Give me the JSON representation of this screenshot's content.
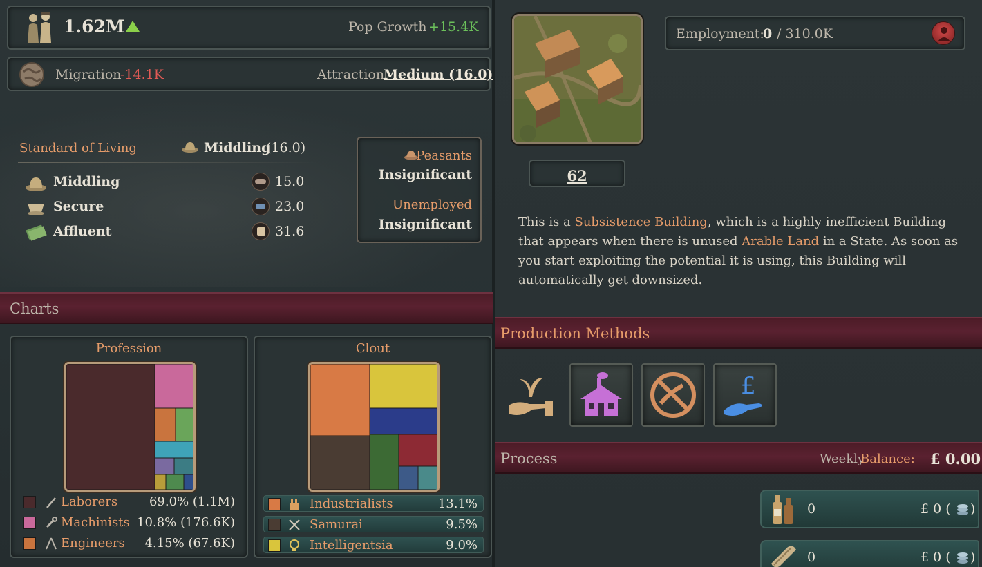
{
  "population": {
    "total": "1.62M",
    "growth_label": "Pop Growth",
    "growth_value": "+15.4K"
  },
  "migration": {
    "label": "Migration",
    "value": "-14.1K",
    "attraction_label": "Attraction",
    "attraction_value": "Medium (16.0)"
  },
  "standard_of_living": {
    "label": "Standard of Living",
    "value_name": "Middling",
    "value_num": "(16.0)",
    "levels": [
      {
        "name": "Middling",
        "value": "15.0"
      },
      {
        "name": "Secure",
        "value": "23.0"
      },
      {
        "name": "Affluent",
        "value": "31.6"
      }
    ]
  },
  "groups": {
    "peasants_label": "Peasants",
    "peasants_value": "Insignificant",
    "unemployed_label": "Unemployed",
    "unemployed_value": "Insignificant"
  },
  "charts": {
    "section_title": "Charts",
    "profession_title": "Profession",
    "clout_title": "Clout",
    "profession_legend": [
      {
        "name": "Laborers",
        "value": "69.0% (1.1M)",
        "color": "#4a2a2c"
      },
      {
        "name": "Machinists",
        "value": "10.8% (176.6K)",
        "color": "#c9699b"
      },
      {
        "name": "Engineers",
        "value": "4.15% (67.6K)",
        "color": "#c9743e"
      }
    ],
    "clout_legend": [
      {
        "name": "Industrialists",
        "value": "13.1%",
        "color": "#d87a45"
      },
      {
        "name": "Samurai",
        "value": "9.5%",
        "color": "#4a3c33"
      },
      {
        "name": "Intelligentsia",
        "value": "9.0%",
        "color": "#d9c53c"
      }
    ]
  },
  "chart_data": [
    {
      "type": "treemap",
      "title": "Profession",
      "categories": [
        "Laborers",
        "Machinists",
        "Engineers"
      ],
      "values": [
        69.0,
        10.8,
        4.15
      ]
    },
    {
      "type": "treemap",
      "title": "Clout",
      "categories": [
        "Industrialists",
        "Samurai",
        "Intelligentsia"
      ],
      "values": [
        13.1,
        9.5,
        9.0
      ]
    }
  ],
  "building": {
    "level": "62",
    "employment_label": "Employment:",
    "employment_current": "0",
    "employment_max": "/ 310.0K",
    "desc_1": "This is a ",
    "desc_link_1": "Subsistence Building",
    "desc_2": ", which is a highly inefficient Building that appears when there is unused ",
    "desc_link_2": "Arable Land",
    "desc_3": " in a State. As soon as you start exploiting the potential it is using, this Building will automatically get downsized."
  },
  "production": {
    "title": "Production Methods"
  },
  "process": {
    "title": "Process",
    "balance_label_1": "Weekly ",
    "balance_label_2": "Balance:",
    "balance_value": "£ 0.00",
    "goods": [
      {
        "amount": "0",
        "price": "£ 0 (",
        "close": ")"
      },
      {
        "amount": "0",
        "price": "£ 0 (",
        "close": ")"
      }
    ]
  }
}
